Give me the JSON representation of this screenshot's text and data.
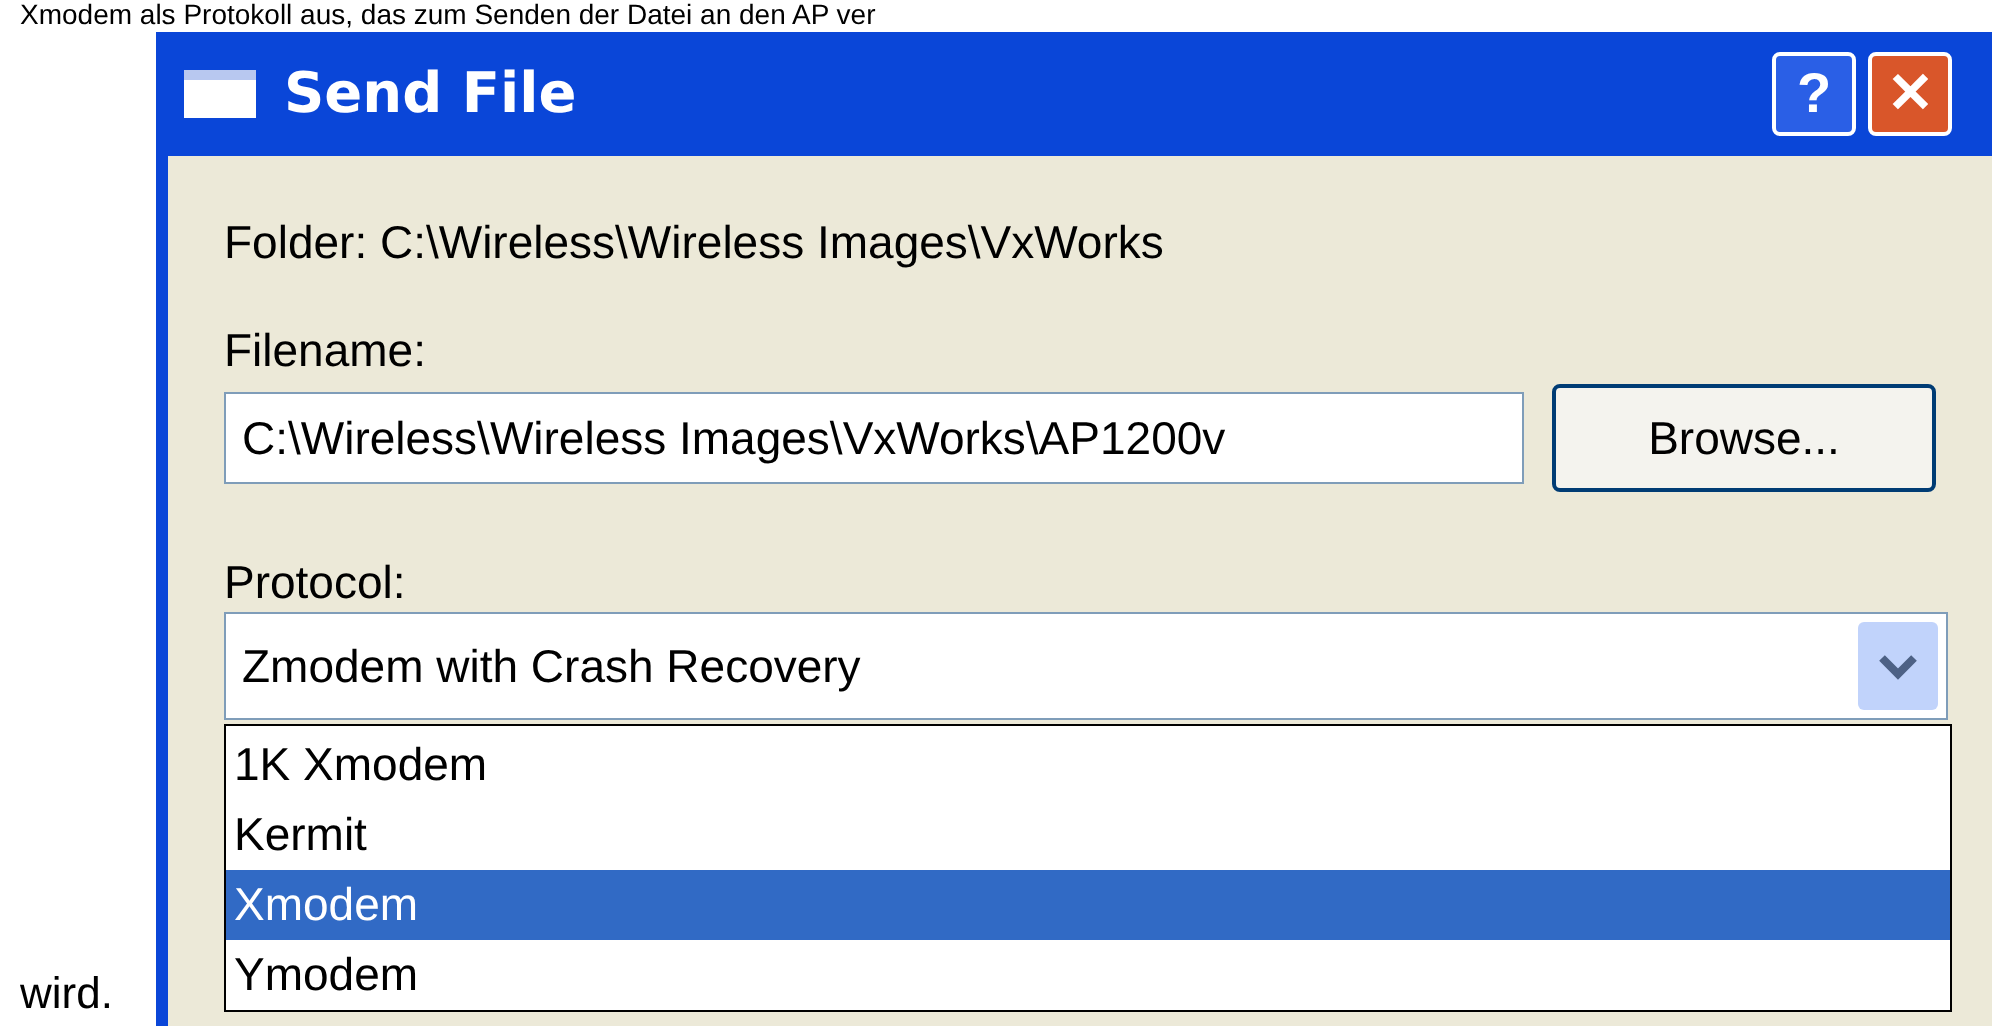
{
  "page_text": {
    "before": "Xmodem als Protokoll aus, das zum Senden der Datei an den AP ver",
    "after": "wird."
  },
  "window": {
    "title": "Send File",
    "buttons": [
      {
        "kind": "help",
        "label": "?"
      },
      {
        "kind": "close",
        "label": "✕"
      }
    ]
  },
  "folder": "Folder:  C:\\Wireless\\Wireless Images\\VxWorks",
  "filename": {
    "label": "Filename:",
    "value": "C:\\Wireless\\Wireless Images\\VxWorks\\AP1200v"
  },
  "browse_button": "Browse...",
  "protocol": {
    "label": "Protocol:",
    "value": "Zmodem with Crash Recovery",
    "expanded": true,
    "options": [
      {
        "label": "1K Xmodem",
        "selected": false
      },
      {
        "label": "Kermit",
        "selected": false
      },
      {
        "label": "Xmodem",
        "selected": true
      },
      {
        "label": "Ymodem",
        "selected": false
      }
    ]
  }
}
